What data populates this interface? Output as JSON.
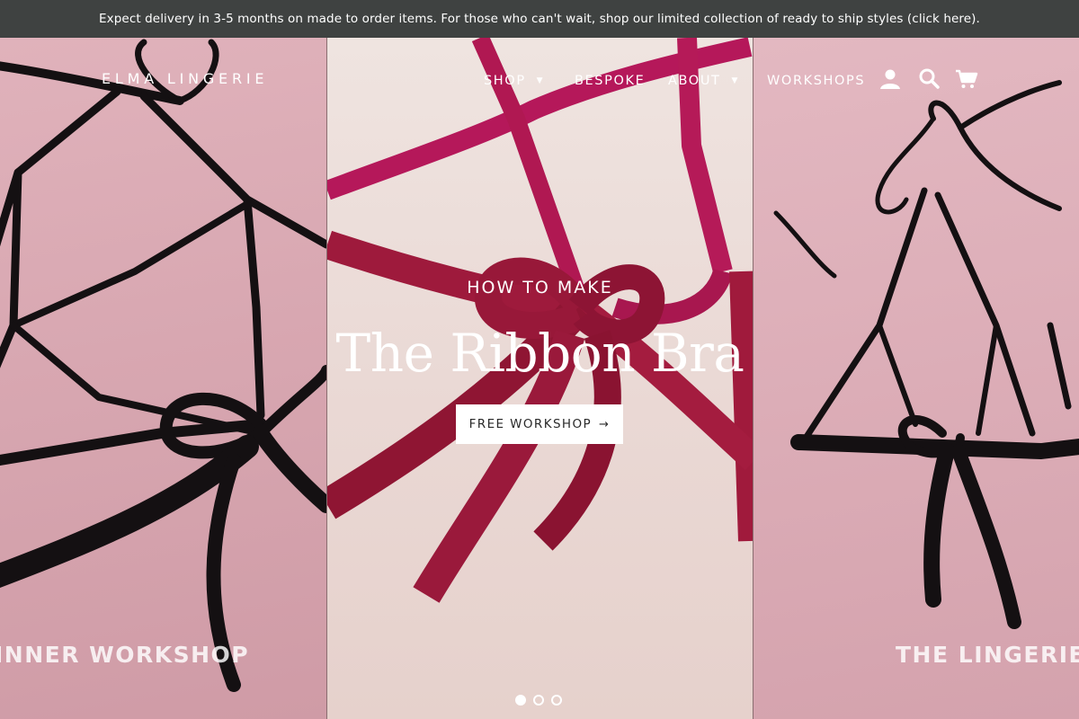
{
  "announcement": {
    "text": "Expect delivery in 3-5 months on made to order items. For those who can't wait, shop our limited collection of ready to ship styles (click here)."
  },
  "header": {
    "logo": "ELMA LINGERIE",
    "nav": {
      "shop": "SHOP",
      "bespoke": "BESPOKE",
      "about": "ABOUT",
      "workshops": "WORKSHOPS"
    },
    "icons": [
      "account-icon",
      "search-icon",
      "cart-icon"
    ]
  },
  "hero": {
    "eyebrow": "HOW TO MAKE",
    "headline": "The Ribbon Bra",
    "cta_label": "FREE WORKSHOP",
    "cta_arrow": "→",
    "left_caption": "INNER WORKSHOP",
    "right_caption": "THE LINGERIE",
    "slide_count": 3,
    "active_slide": 1
  },
  "colors": {
    "announcement_bg": "#3f4241",
    "pink_panel": "#d8a7b1",
    "cream_panel": "#ecdcd8",
    "red_ribbon": "#a01a3c",
    "black_ribbon": "#141012"
  }
}
